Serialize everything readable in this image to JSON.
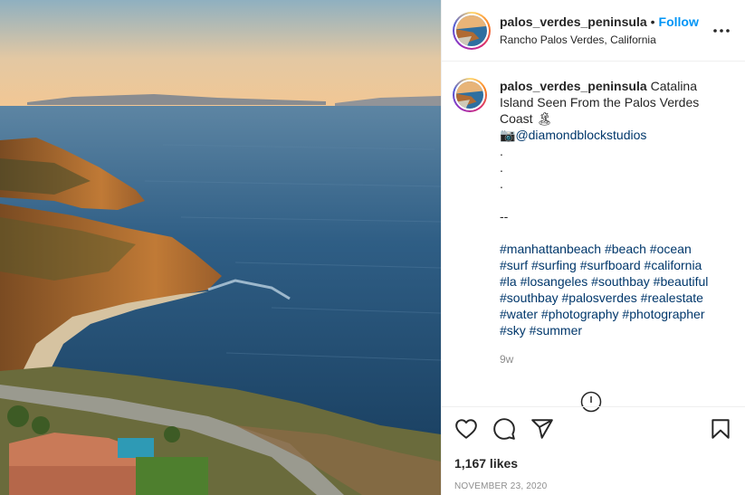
{
  "post": {
    "username": "palos_verdes_peninsula",
    "separator": "•",
    "follow_label": "Follow",
    "location": "Rancho Palos Verdes, California",
    "more_icon": "more-options-icon"
  },
  "caption": {
    "username": "palos_verdes_peninsula",
    "title": "Catalina Island Seen From the Palos Verdes Coast 🏝",
    "credit_prefix": "📷",
    "credit_mention": "@diamondblockstudios",
    "dots": [
      ".",
      ".",
      "."
    ],
    "dashes": "--",
    "hashtags": "#manhattanbeach #beach #ocean #surf #surfing #surfboard #california #la #losangeles #southbay #beautiful #southbay #palosverdes #realestate #water #photography #photographer #sky #summer",
    "time_ago": "9w"
  },
  "stats": {
    "likes": "1,167 likes",
    "date": "NOVEMBER 23, 2020"
  },
  "icons": {
    "like": "heart-icon",
    "comment": "comment-icon",
    "share": "share-icon",
    "save": "bookmark-icon",
    "load": "load-more-icon"
  },
  "colors": {
    "follow": "#0095f6",
    "link": "#00376b",
    "muted": "#8e8e8e",
    "text": "#262626"
  }
}
